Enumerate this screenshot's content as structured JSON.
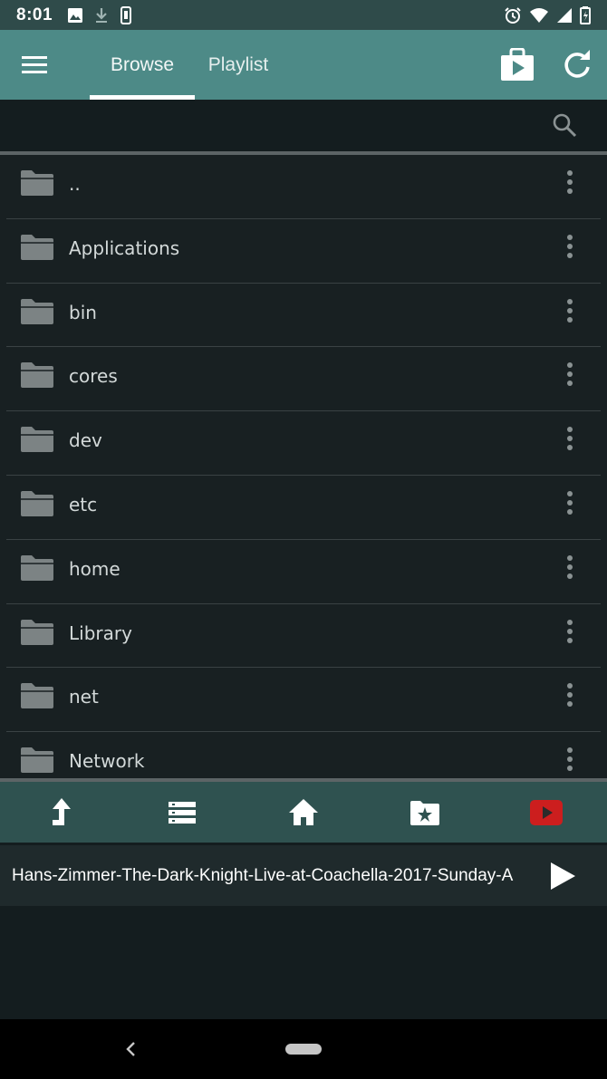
{
  "status_bar": {
    "time": "8:01",
    "icons_left": [
      "image-icon",
      "download-icon",
      "phone-vibrate-icon"
    ],
    "icons_right": [
      "alarm-icon",
      "wifi-icon",
      "signal-icon",
      "battery-icon"
    ]
  },
  "app_bar": {
    "tabs": [
      {
        "label": "Browse",
        "active": true
      },
      {
        "label": "Playlist",
        "active": false
      }
    ],
    "icons": [
      "menu-icon",
      "store-play-icon",
      "refresh-icon"
    ]
  },
  "search": {
    "icon": "search-icon"
  },
  "file_list": {
    "items": [
      {
        "name": ".."
      },
      {
        "name": "Applications"
      },
      {
        "name": "bin"
      },
      {
        "name": "cores"
      },
      {
        "name": "dev"
      },
      {
        "name": "etc"
      },
      {
        "name": "home"
      },
      {
        "name": "Library"
      },
      {
        "name": "net"
      },
      {
        "name": "Network"
      }
    ],
    "item_icon": "folder-icon",
    "overflow_icon": "more-vertical-icon"
  },
  "toolbar": {
    "buttons": [
      "up-arrow-icon",
      "list-icon",
      "home-icon",
      "folder-star-icon",
      "youtube-icon"
    ]
  },
  "now_playing": {
    "title": "Hans-Zimmer-The-Dark-Knight-Live-at-Coachella-2017-Sunday-A",
    "icon": "play-icon"
  },
  "colors": {
    "app_bar": "#4d8a87",
    "status_bar": "#2f4b4a",
    "toolbar": "#2f5250",
    "background": "#141d1f",
    "youtube_red": "#cc1e1e"
  }
}
